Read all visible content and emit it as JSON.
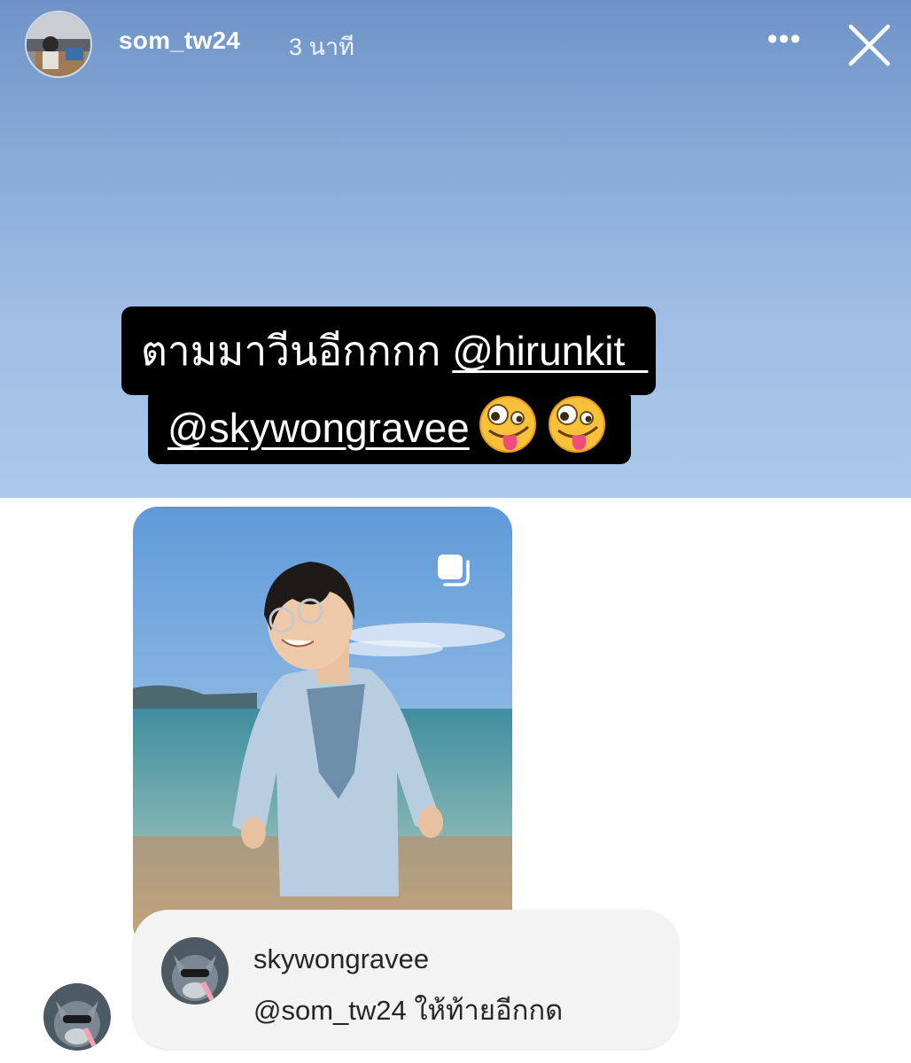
{
  "header": {
    "username": "som_tw24",
    "time_ago": "3 นาที",
    "more_label": "•••",
    "close_icon": "close-icon"
  },
  "caption": {
    "line1_text": "ตามมาวีนอีกกกก ",
    "line1_mention": "@hirunkit_",
    "line2_mention": "@skywongravee",
    "emoji": "zany-face"
  },
  "shared_post": {
    "icon": "carousel-icon"
  },
  "comment": {
    "username": "skywongravee",
    "text": "@som_tw24 ให้ท้ายอีกกด"
  },
  "colors": {
    "sky_top": "#6f93c6",
    "sky_bottom": "#acc8ea",
    "caption_bg": "#000000",
    "comment_bg": "#f3f3f3"
  }
}
